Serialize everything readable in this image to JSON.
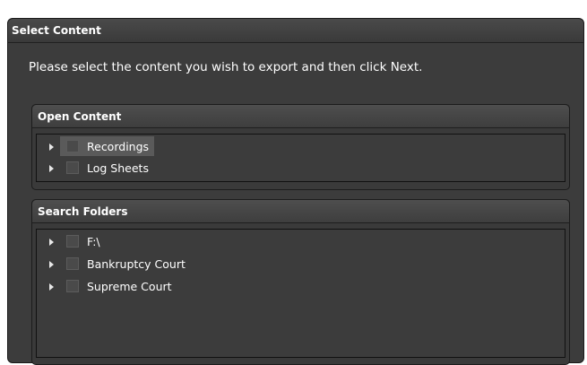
{
  "panel": {
    "title": "Select Content",
    "instructions": "Please select the content you wish to export and then click Next."
  },
  "open_content": {
    "title": "Open Content",
    "items": [
      {
        "label": "Recordings",
        "checked": false,
        "highlighted": true
      },
      {
        "label": "Log Sheets",
        "checked": false,
        "highlighted": false
      }
    ]
  },
  "search_folders": {
    "title": "Search Folders",
    "items": [
      {
        "label": "F:\\",
        "checked": false
      },
      {
        "label": "Bankruptcy Court",
        "checked": false
      },
      {
        "label": "Supreme Court",
        "checked": false
      }
    ]
  },
  "colors": {
    "panel_bg": "#3c3c3c",
    "header_bg": "#4a4a4a",
    "text": "#ffffff",
    "highlight": "#5a5a5a"
  },
  "icons": {
    "expander": "triangle-right-icon",
    "checkbox": "checkbox-unchecked-icon"
  }
}
